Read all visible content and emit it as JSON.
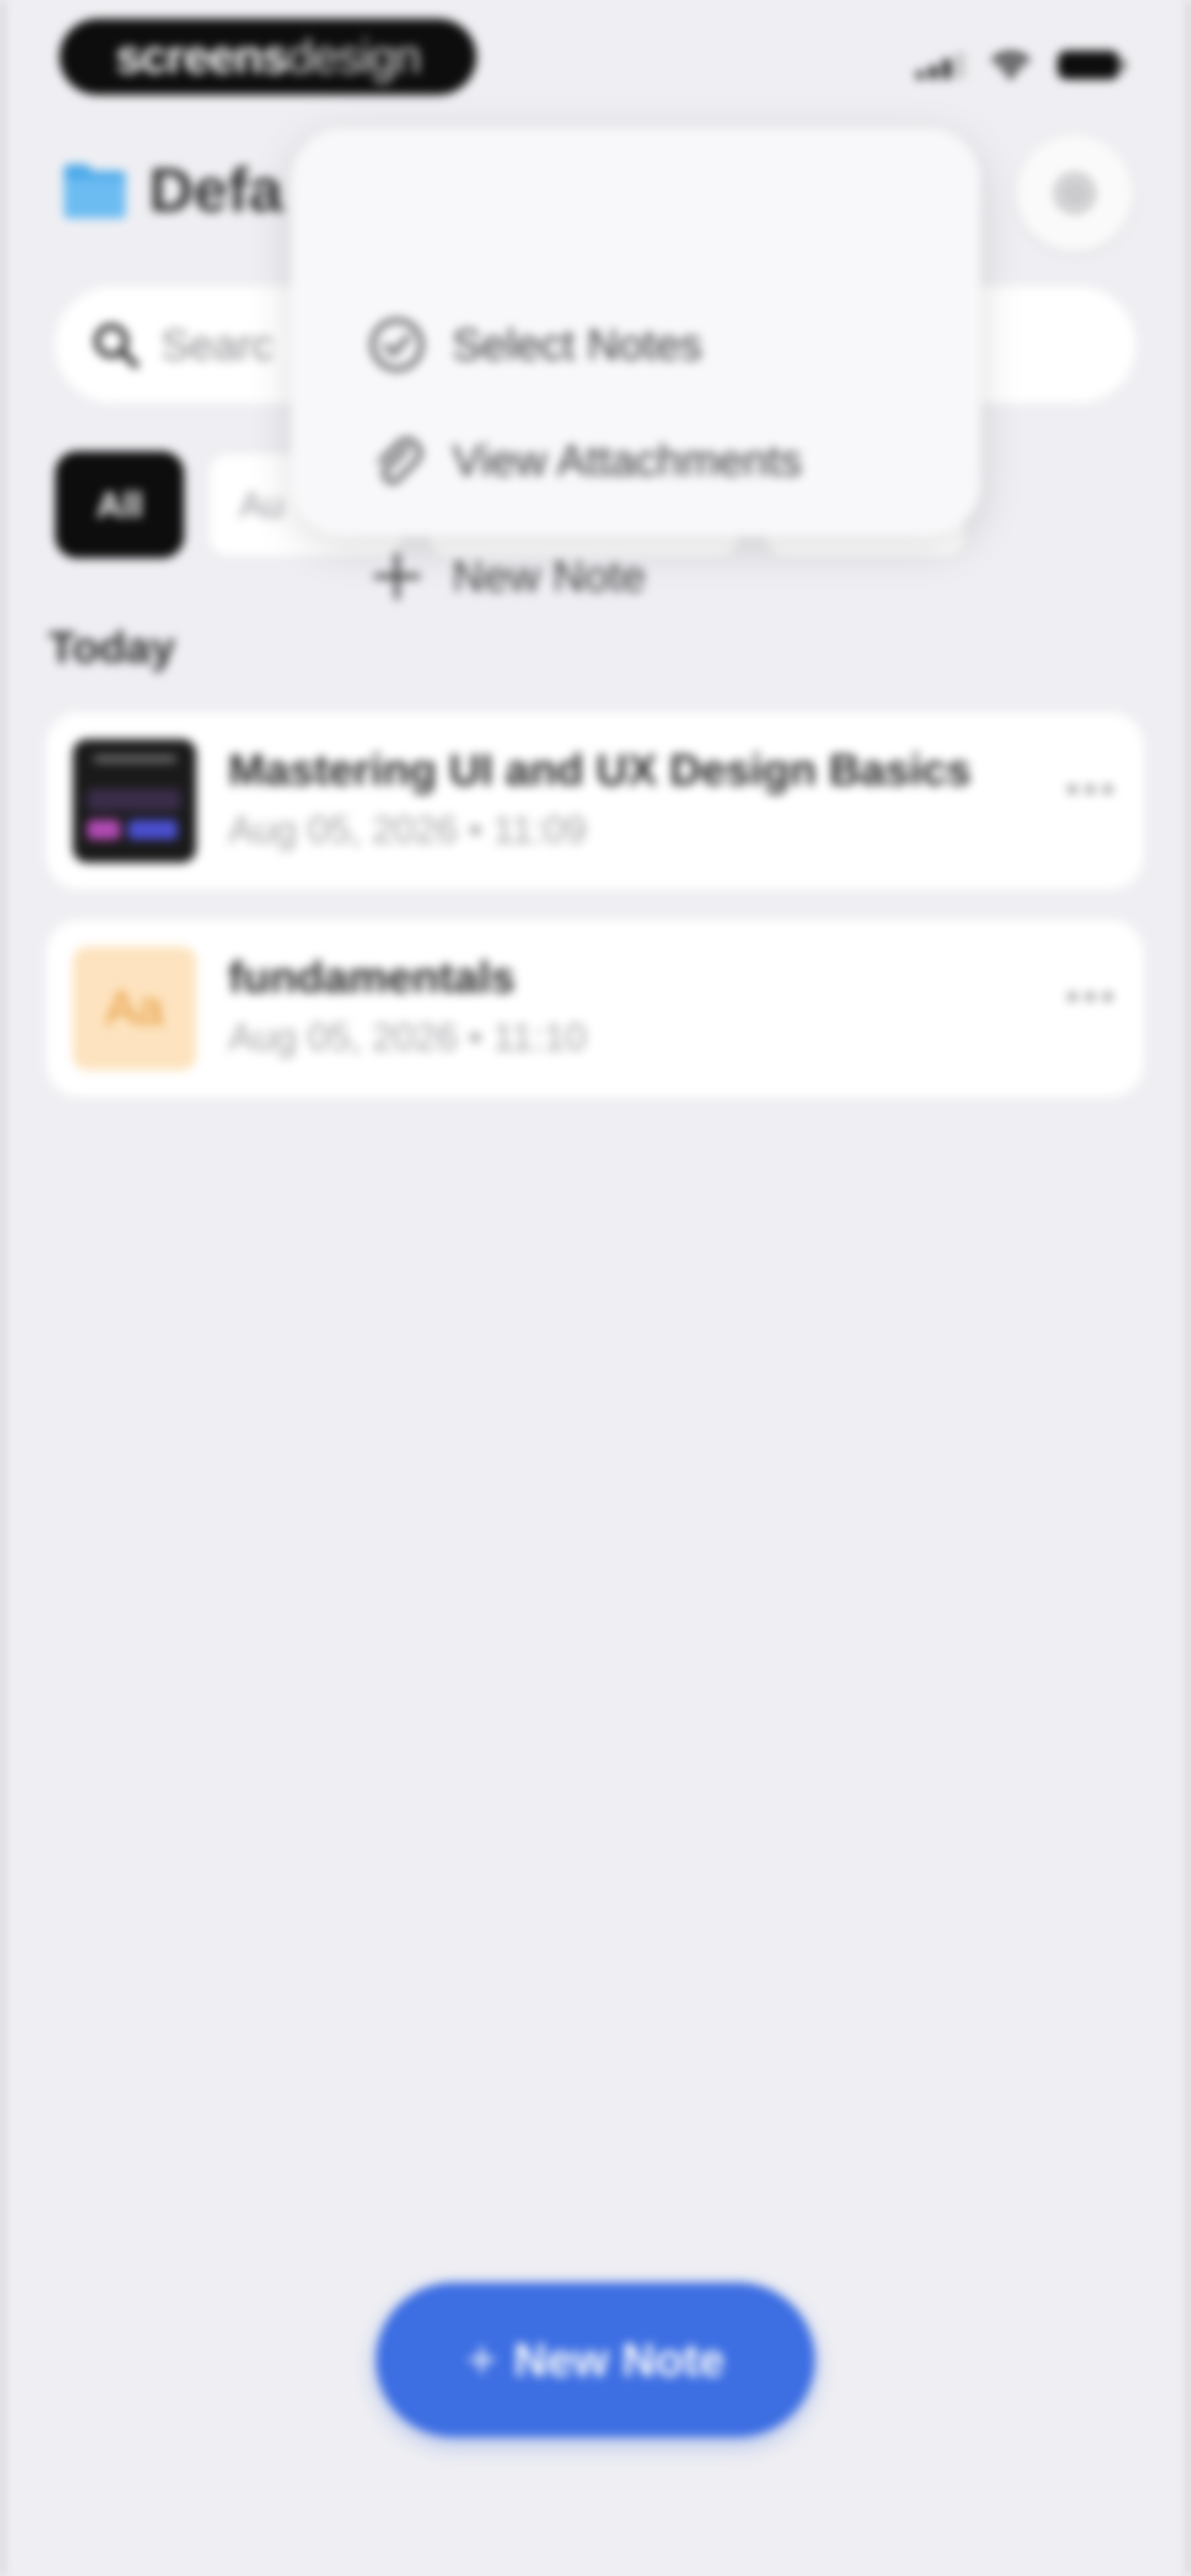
{
  "status_bar": {
    "logo_bold": "screens",
    "logo_light": "design"
  },
  "header": {
    "title": "Defa"
  },
  "context_menu": {
    "items": [
      {
        "label": "Select Notes",
        "icon": "check-circle-icon"
      },
      {
        "label": "View Attachments",
        "icon": "paperclip-icon"
      },
      {
        "label": "New Note",
        "icon": "plus-icon"
      }
    ]
  },
  "search": {
    "placeholder": "Searc"
  },
  "filters": {
    "items": [
      {
        "label": "All",
        "active": true
      },
      {
        "label": "Au",
        "active": false
      }
    ]
  },
  "section": {
    "label": "Today"
  },
  "notes": [
    {
      "title": "Mastering UI and UX Design Basics",
      "meta": "Aug 05, 2026 • 11:09",
      "thumb": "image"
    },
    {
      "title": "fundamentals",
      "meta": "Aug 05, 2026 • 11:10",
      "thumb": "Aa"
    }
  ],
  "fab": {
    "label": "New Note"
  },
  "colors": {
    "accent": "#3d6ee2",
    "background": "#efeff3",
    "folder": "#4aa8e8",
    "note_thumb_text": "#e69a39"
  }
}
